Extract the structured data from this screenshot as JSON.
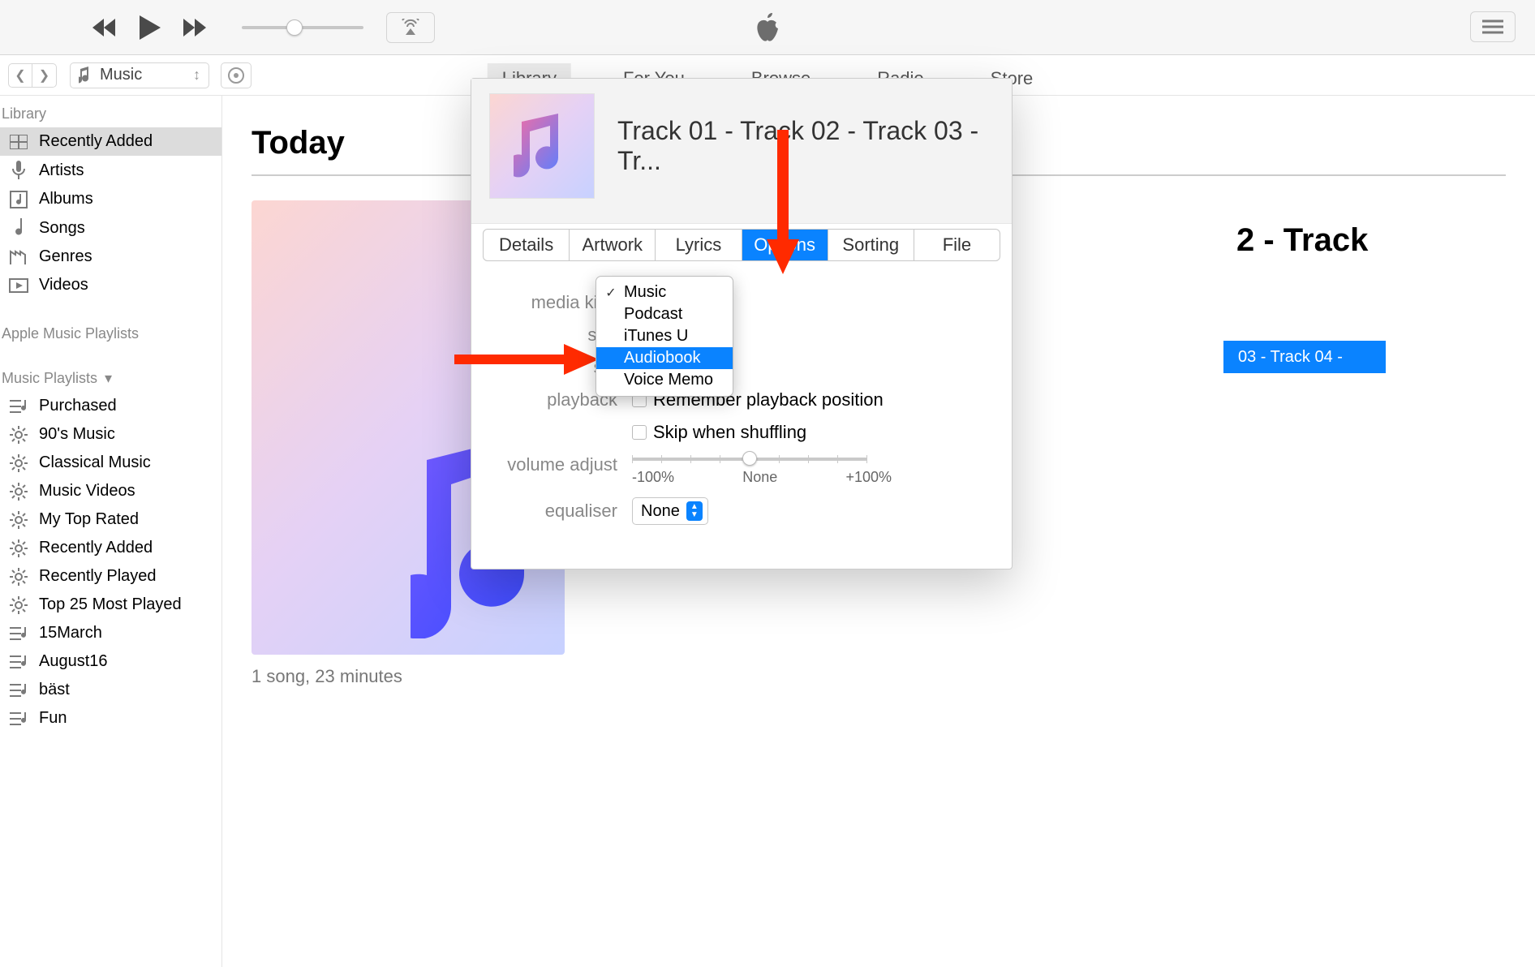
{
  "topnav": {
    "library": "Library",
    "foryou": "For You",
    "browse": "Browse",
    "radio": "Radio",
    "store": "Store"
  },
  "mediadropdown": "Music",
  "sidebar": {
    "library_label": "Library",
    "items": [
      {
        "icon": "grid",
        "label": "Recently Added",
        "selected": true
      },
      {
        "icon": "mic",
        "label": "Artists"
      },
      {
        "icon": "album",
        "label": "Albums"
      },
      {
        "icon": "note",
        "label": "Songs"
      },
      {
        "icon": "genre",
        "label": "Genres"
      },
      {
        "icon": "video",
        "label": "Videos"
      }
    ],
    "applemusic_label": "Apple Music Playlists",
    "music_playlists_label": "Music Playlists",
    "playlists": [
      {
        "icon": "list",
        "label": "Purchased"
      },
      {
        "icon": "gear",
        "label": "90's Music"
      },
      {
        "icon": "gear",
        "label": "Classical Music"
      },
      {
        "icon": "gear",
        "label": "Music Videos"
      },
      {
        "icon": "gear",
        "label": "My Top Rated"
      },
      {
        "icon": "gear",
        "label": "Recently Added"
      },
      {
        "icon": "gear",
        "label": "Recently Played"
      },
      {
        "icon": "gear",
        "label": "Top 25 Most Played"
      },
      {
        "icon": "list",
        "label": "15March"
      },
      {
        "icon": "list",
        "label": "August16"
      },
      {
        "icon": "list",
        "label": "bäst"
      },
      {
        "icon": "list",
        "label": "Fun"
      }
    ]
  },
  "main": {
    "heading": "Today",
    "songline": "1 song, 23 minutes",
    "bg_track_title": "2 - Track",
    "bg_track_row": "03 - Track 04 -"
  },
  "dialog": {
    "title": "Track 01 - Track 02 - Track 03 - Tr...",
    "tabs": [
      "Details",
      "Artwork",
      "Lyrics",
      "Options",
      "Sorting",
      "File"
    ],
    "active_tab": 3,
    "labels": {
      "media_kind": "media kind",
      "start": "star",
      "stop": "sto",
      "playback": "playback",
      "volume_adjust": "volume adjust",
      "equaliser": "equaliser"
    },
    "playback_remember": "Remember playback position",
    "playback_skip": "Skip when shuffling",
    "vol_minus": "-100%",
    "vol_none": "None",
    "vol_plus": "+100%",
    "eq_value": "None"
  },
  "popup": {
    "items": [
      "Music",
      "Podcast",
      "iTunes U",
      "Audiobook",
      "Voice Memo"
    ],
    "checked": 0,
    "highlight": 3
  }
}
